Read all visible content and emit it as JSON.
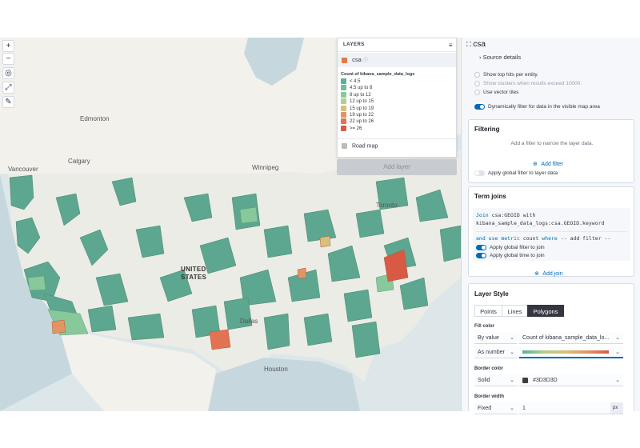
{
  "map": {
    "cities": [
      {
        "name": "Edmonton"
      },
      {
        "name": "Calgary"
      },
      {
        "name": "Vancouver"
      },
      {
        "name": "Winnipeg"
      },
      {
        "name": "Toronto"
      },
      {
        "name": "UNITED STATES"
      },
      {
        "name": "Houston"
      },
      {
        "name": "Dallas"
      }
    ]
  },
  "layers_panel": {
    "title": "LAYERS",
    "layer_name": "csa",
    "legend_title": "Count of kibana_sample_data_logs",
    "legend": [
      {
        "label": "< 4.5",
        "color": "#54B399"
      },
      {
        "label": "4.5 up to 8",
        "color": "#6DC09C"
      },
      {
        "label": "8 up to 12",
        "color": "#88C99B"
      },
      {
        "label": "12 up to 15",
        "color": "#B3CF8B"
      },
      {
        "label": "15 up to 19",
        "color": "#D6C178"
      },
      {
        "label": "19 up to 22",
        "color": "#E29563"
      },
      {
        "label": "22 up to 26",
        "color": "#E17352"
      },
      {
        "label": ">= 26",
        "color": "#D85A45"
      }
    ],
    "road_map": "Road map",
    "add_layer": "Add layer"
  },
  "right_panel": {
    "title": "csa",
    "source_details": "Source details",
    "options": [
      "Show top hits per entity.",
      "Show clusters when results exceed 10000.",
      "Use vector tiles"
    ],
    "dynamic_filter": "Dynamically filter for data in the visible map area",
    "filtering": {
      "title": "Filtering",
      "hint": "Add a filter to narrow the layer data.",
      "add_filter": "Add filter",
      "global_filter": "Apply global filter to layer data"
    },
    "term_joins": {
      "title": "Term joins",
      "join_kw": "Join",
      "join_text": "csa:GEOID with",
      "join_text2": "kibana_sample_data_logs:csa.GEOID.keyword",
      "metric_line_and": "and",
      "metric_line_use": "use",
      "metric_line_metric": "metric",
      "metric_line_count": "count",
      "metric_line_where": "where",
      "metric_line_rest": "-- add filter --",
      "global_filter": "Apply global filter to join",
      "global_time": "Apply global time to join",
      "add_join": "Add join"
    },
    "layer_style": {
      "title": "Layer Style",
      "tabs": [
        "Points",
        "Lines",
        "Polygons"
      ],
      "fill_color": "Fill color",
      "by_value": "By value",
      "field": "Count of kibana_sample_data_lo...",
      "as_number": "As number",
      "border_color": "Border color",
      "solid": "Solid",
      "border_hex": "#3D3D3D",
      "border_width": "Border width",
      "fixed": "Fixed",
      "width_value": "1",
      "width_unit": "px"
    }
  }
}
